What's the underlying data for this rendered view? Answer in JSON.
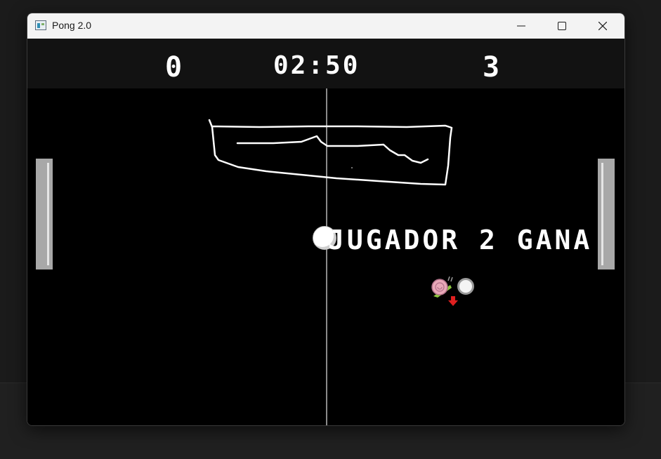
{
  "window": {
    "title": "Pong 2.0",
    "icon": "app-window-icon",
    "controls": [
      "minimize-icon",
      "maximize-icon",
      "close-icon"
    ]
  },
  "scoreboard": {
    "left_score": "0",
    "timer": "02:50",
    "right_score": "3"
  },
  "game": {
    "winner_message": "JUGADOR 2 GANA",
    "powerups": [
      "snail-icon",
      "ball-icon",
      "down-arrow-icon"
    ],
    "colors": {
      "background": "#000000",
      "paddle": "#a8a8a8",
      "text": "#ffffff",
      "arrow": "#e02020"
    }
  }
}
